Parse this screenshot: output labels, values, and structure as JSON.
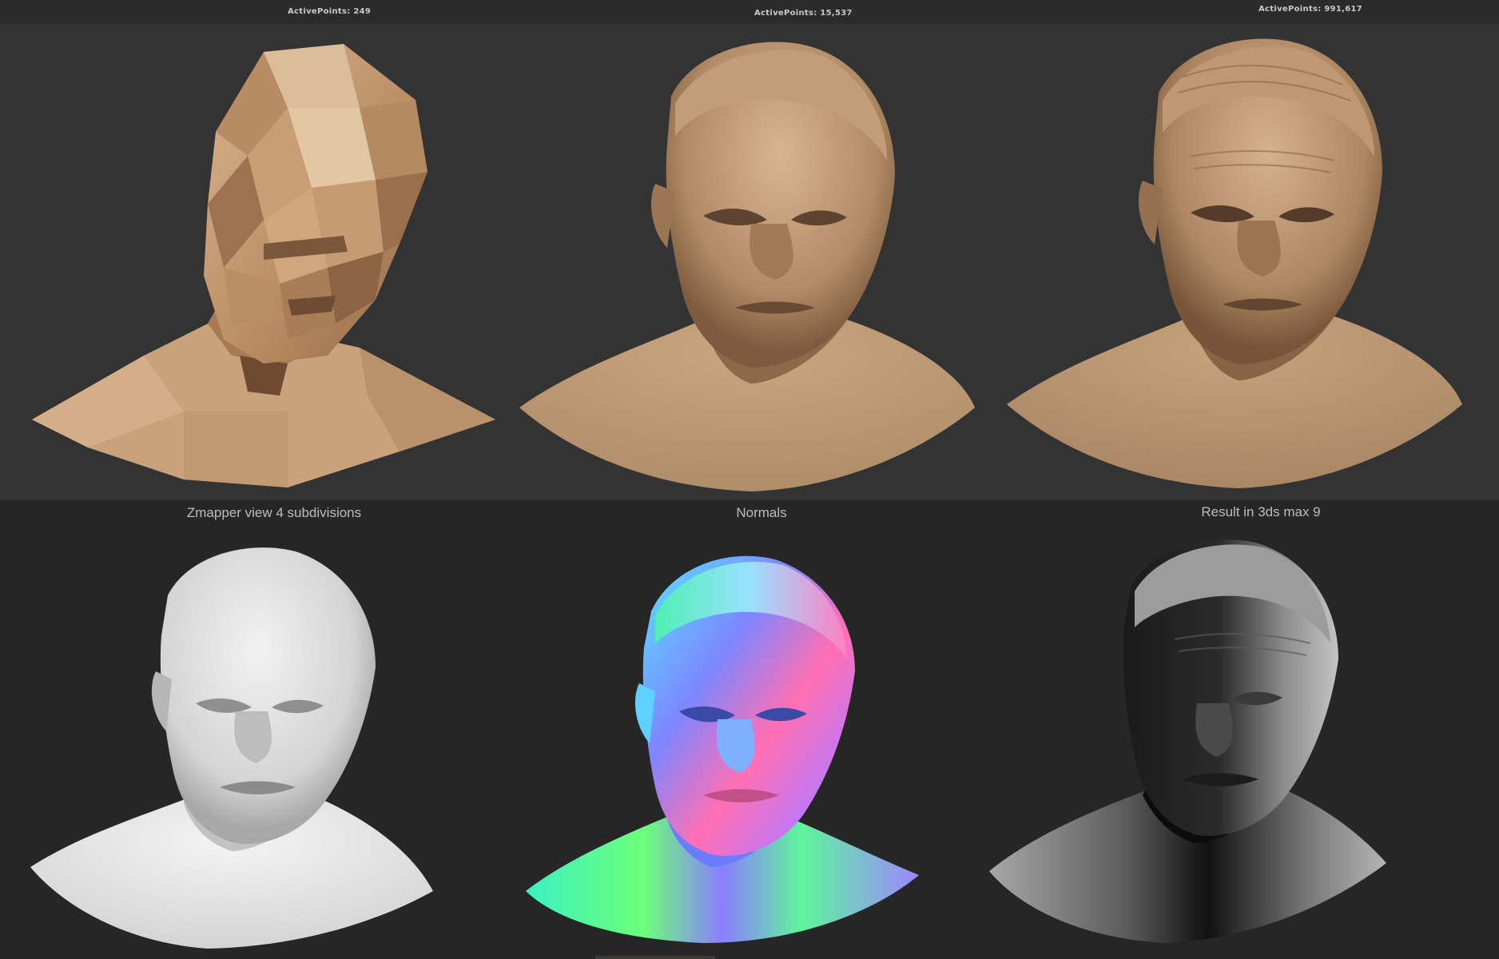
{
  "top_row": {
    "panels": [
      {
        "active_points_label": "ActivePoints: 249",
        "stage": "low-poly base mesh"
      },
      {
        "active_points_label": "ActivePoints: 15,537",
        "stage": "mid subdivision sculpt"
      },
      {
        "active_points_label": "ActivePoints: 991,617",
        "stage": "high subdivision sculpt"
      }
    ],
    "material_color": "#c49a72"
  },
  "bottom_row": {
    "captions": [
      "Zmapper view 4 subdivisions",
      "Normals",
      "Result in 3ds max 9"
    ],
    "colors": {
      "zmapper": "#e6e6e6",
      "normals_a": "#4df0a6",
      "normals_b": "#b07bff",
      "normals_c": "#ff6fb0",
      "result": "#9a9a9a"
    }
  }
}
